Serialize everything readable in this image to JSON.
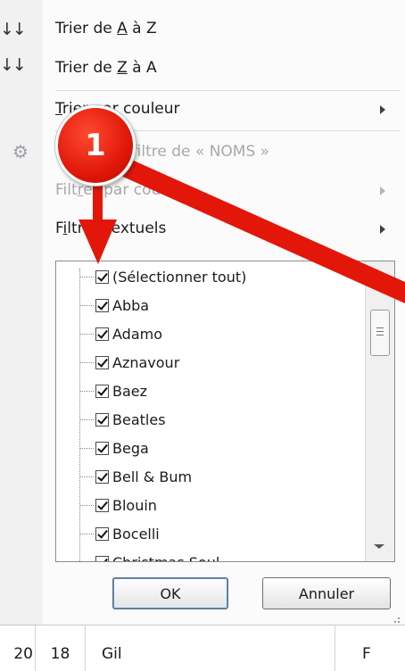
{
  "menu": {
    "sort_az": {
      "prefix": "Trier de ",
      "key": "A",
      "suffix": " à Z"
    },
    "sort_za": {
      "prefix": "Trier de ",
      "key": "Z",
      "suffix": " à A"
    },
    "sort_by_color": {
      "key": "T",
      "rest": "rier par couleur"
    },
    "clear_filter": "Effacer le filtre de « NOMS »",
    "filter_by_color": {
      "prefix": "Filt",
      "key": "r",
      "suffix": "er par couleur"
    },
    "text_filters": {
      "prefix": "F",
      "key": "i",
      "suffix": "ltres textuels"
    }
  },
  "values_list": {
    "select_all_label": "(Sélectionner tout)",
    "items": [
      "Abba",
      "Adamo",
      "Aznavour",
      "Baez",
      "Beatles",
      "Bega",
      "Bell & Bum",
      "Blouin",
      "Bocelli",
      "Christmas Soul"
    ]
  },
  "buttons": {
    "ok": "OK",
    "cancel": "Annuler"
  },
  "annotation": {
    "number": "1",
    "color": "#e2170a"
  },
  "sheet_row": {
    "cells": [
      "20",
      "18",
      "Gil",
      "F"
    ]
  },
  "icons": {
    "sort_az": "sort-ascending-icon",
    "sort_za": "sort-descending-icon",
    "clear_filter": "clear-filter-icon"
  }
}
